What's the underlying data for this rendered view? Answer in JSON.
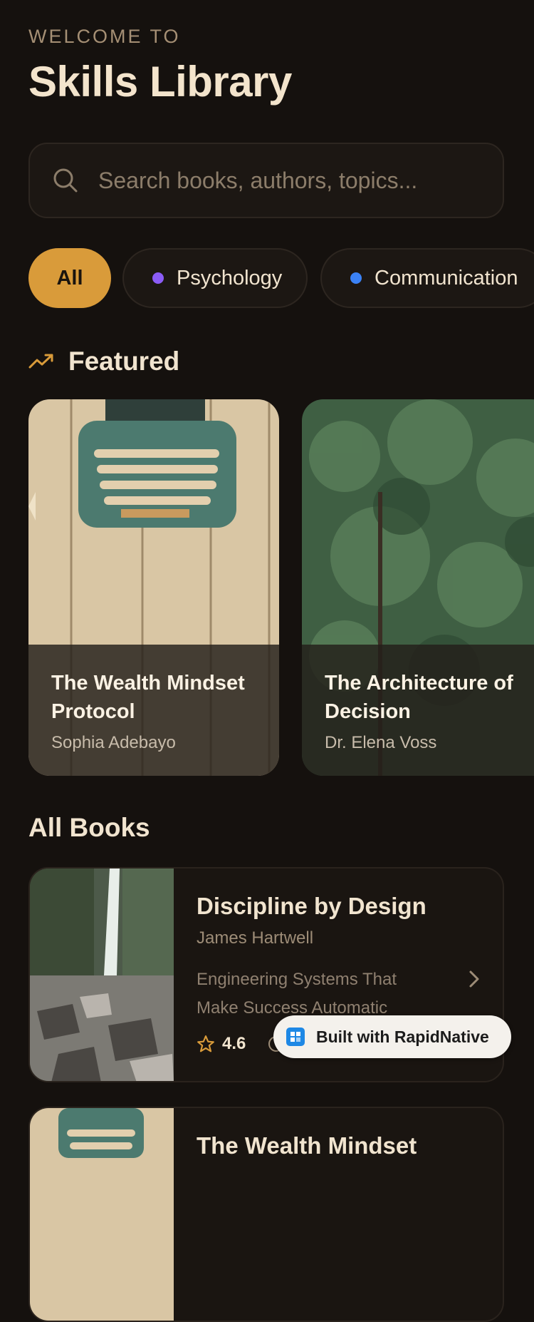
{
  "header": {
    "eyebrow": "WELCOME TO",
    "title": "Skills Library"
  },
  "search": {
    "placeholder": "Search books, authors, topics..."
  },
  "chips": [
    {
      "label": "All",
      "active": true
    },
    {
      "label": "Psychology",
      "dot_color": "#8b5cf6"
    },
    {
      "label": "Communication",
      "dot_color": "#3b82f6"
    }
  ],
  "featured": {
    "heading": "Featured",
    "items": [
      {
        "title": "The Wealth Mindset Protocol",
        "author": "Sophia Adebayo"
      },
      {
        "title": "The Architecture of Decision",
        "author": "Dr. Elena Voss"
      }
    ]
  },
  "all_books": {
    "heading": "All Books",
    "items": [
      {
        "title": "Discipline by Design",
        "author": "James Hartwell",
        "subtitle": "Engineering Systems That Make Success Automatic",
        "rating": "4.6"
      },
      {
        "title": "The Wealth Mindset"
      }
    ]
  },
  "badge": {
    "label": "Built with RapidNative"
  },
  "colors": {
    "accent": "#d99b3a",
    "background": "#15110e"
  }
}
